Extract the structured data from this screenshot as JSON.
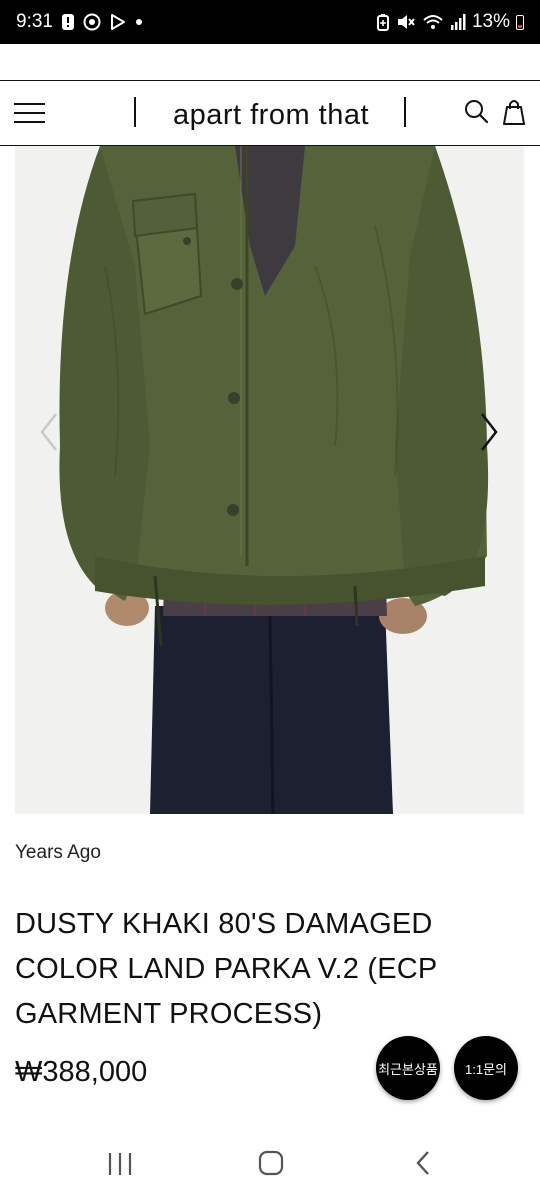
{
  "status_bar": {
    "time": "9:31",
    "battery": "13%",
    "left_icons": [
      "alert-icon",
      "app-icon",
      "play-store-icon",
      "dot-icon"
    ],
    "right_icons": [
      "battery-saver-icon",
      "mute-icon",
      "wifi-icon",
      "signal-icon",
      "battery-icon"
    ]
  },
  "header": {
    "brand": "apart from that",
    "menu_icon": "hamburger-menu-icon",
    "search_icon": "search-icon",
    "cart_icon": "shopping-bag-icon"
  },
  "product": {
    "image_subject": "khaki-parka-photo",
    "brand": "Years Ago",
    "title": "DUSTY KHAKI 80'S DAMAGED COLOR LAND PARKA V.2 (ECP GARMENT PROCESS)",
    "price": "₩388,000"
  },
  "floating_buttons": {
    "recent": "최근본상품",
    "inquiry": "1:1문의"
  },
  "nav_bar": {
    "icons": [
      "recent-apps-icon",
      "home-icon",
      "back-icon"
    ]
  }
}
